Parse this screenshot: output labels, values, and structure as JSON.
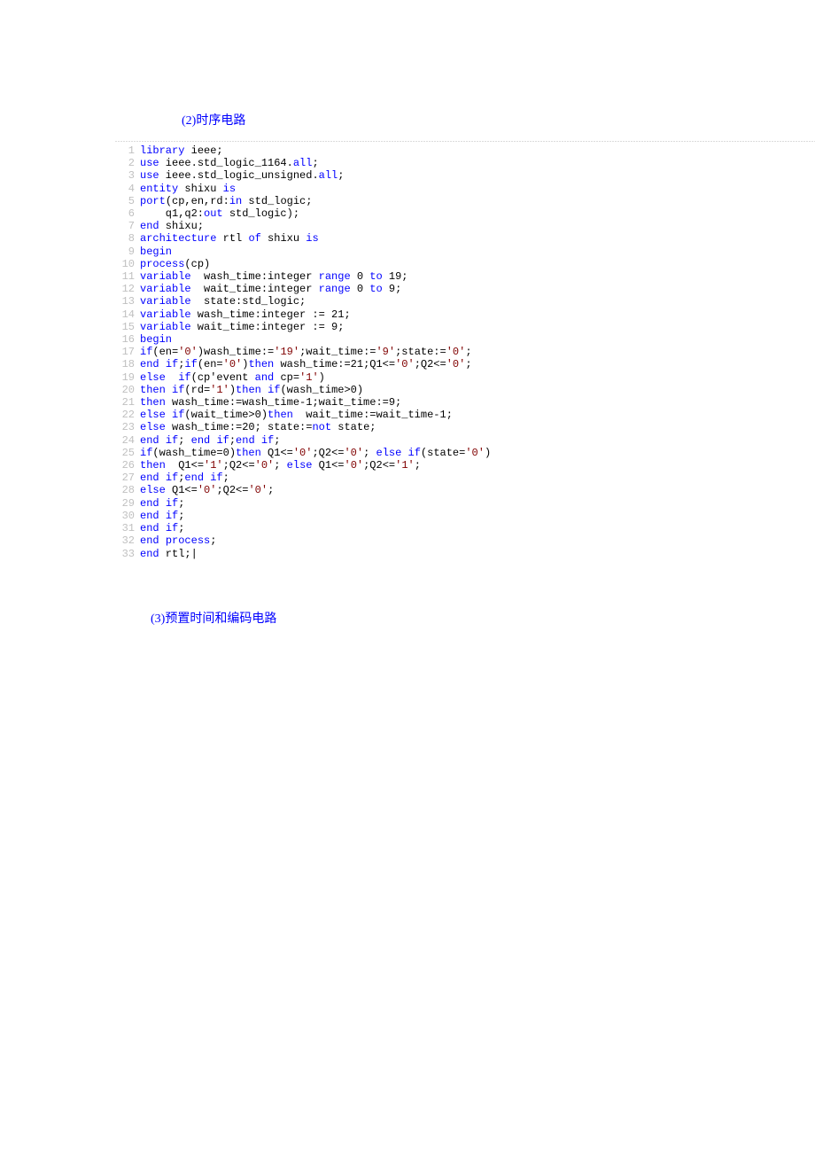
{
  "headings": {
    "h1": "(2)时序电路",
    "h2": "(3)预置时间和编码电路"
  },
  "code": [
    {
      "n": "1",
      "segs": [
        [
          "kw",
          "library"
        ],
        [
          "tx",
          " ieee;"
        ]
      ]
    },
    {
      "n": "2",
      "segs": [
        [
          "kw",
          "use"
        ],
        [
          "tx",
          " ieee.std_logic_1164."
        ],
        [
          "kw",
          "all"
        ],
        [
          "tx",
          ";"
        ]
      ]
    },
    {
      "n": "3",
      "segs": [
        [
          "kw",
          "use"
        ],
        [
          "tx",
          " ieee.std_logic_unsigned."
        ],
        [
          "kw",
          "all"
        ],
        [
          "tx",
          ";"
        ]
      ]
    },
    {
      "n": "4",
      "segs": [
        [
          "kw",
          "entity"
        ],
        [
          "tx",
          " shixu "
        ],
        [
          "kw",
          "is"
        ]
      ]
    },
    {
      "n": "5",
      "segs": [
        [
          "kw",
          "port"
        ],
        [
          "tx",
          "(cp,en,rd:"
        ],
        [
          "kw",
          "in"
        ],
        [
          "tx",
          " std_logic;"
        ]
      ]
    },
    {
      "n": "6",
      "segs": [
        [
          "tx",
          "    q1,q2:"
        ],
        [
          "kw",
          "out"
        ],
        [
          "tx",
          " std_logic);"
        ]
      ]
    },
    {
      "n": "7",
      "segs": [
        [
          "kw",
          "end"
        ],
        [
          "tx",
          " shixu;"
        ]
      ]
    },
    {
      "n": "8",
      "segs": [
        [
          "kw",
          "architecture"
        ],
        [
          "tx",
          " rtl "
        ],
        [
          "kw",
          "of"
        ],
        [
          "tx",
          " shixu "
        ],
        [
          "kw",
          "is"
        ]
      ]
    },
    {
      "n": "9",
      "segs": [
        [
          "kw",
          "begin"
        ]
      ]
    },
    {
      "n": "10",
      "segs": [
        [
          "kw",
          "process"
        ],
        [
          "tx",
          "(cp)"
        ]
      ]
    },
    {
      "n": "11",
      "segs": [
        [
          "kw",
          "variable"
        ],
        [
          "tx",
          "  wash_time:integer "
        ],
        [
          "kw",
          "range"
        ],
        [
          "tx",
          " 0 "
        ],
        [
          "kw",
          "to"
        ],
        [
          "tx",
          " 19;"
        ]
      ]
    },
    {
      "n": "12",
      "segs": [
        [
          "kw",
          "variable"
        ],
        [
          "tx",
          "  wait_time:integer "
        ],
        [
          "kw",
          "range"
        ],
        [
          "tx",
          " 0 "
        ],
        [
          "kw",
          "to"
        ],
        [
          "tx",
          " 9;"
        ]
      ]
    },
    {
      "n": "13",
      "segs": [
        [
          "kw",
          "variable"
        ],
        [
          "tx",
          "  state:std_logic;"
        ]
      ]
    },
    {
      "n": "14",
      "segs": [
        [
          "kw",
          "variable"
        ],
        [
          "tx",
          " wash_time:integer := 21;"
        ]
      ]
    },
    {
      "n": "15",
      "segs": [
        [
          "kw",
          "variable"
        ],
        [
          "tx",
          " wait_time:integer := 9;"
        ]
      ]
    },
    {
      "n": "16",
      "segs": [
        [
          "kw",
          "begin"
        ]
      ]
    },
    {
      "n": "17",
      "segs": [
        [
          "kw",
          "if"
        ],
        [
          "tx",
          "(en="
        ],
        [
          "str",
          "'0'"
        ],
        [
          "tx",
          ")wash_time:="
        ],
        [
          "str",
          "'19'"
        ],
        [
          "tx",
          ";wait_time:="
        ],
        [
          "str",
          "'9'"
        ],
        [
          "tx",
          ";state:="
        ],
        [
          "str",
          "'0'"
        ],
        [
          "tx",
          ";"
        ]
      ]
    },
    {
      "n": "18",
      "segs": [
        [
          "kw",
          "end"
        ],
        [
          "tx",
          " "
        ],
        [
          "kw",
          "if"
        ],
        [
          "tx",
          ";"
        ],
        [
          "kw",
          "if"
        ],
        [
          "tx",
          "(en="
        ],
        [
          "str",
          "'0'"
        ],
        [
          "tx",
          ")"
        ],
        [
          "kw",
          "then"
        ],
        [
          "tx",
          " wash_time:=21;Q1<="
        ],
        [
          "str",
          "'0'"
        ],
        [
          "tx",
          ";Q2<="
        ],
        [
          "str",
          "'0'"
        ],
        [
          "tx",
          ";"
        ]
      ]
    },
    {
      "n": "19",
      "segs": [
        [
          "kw",
          "else"
        ],
        [
          "tx",
          "  "
        ],
        [
          "kw",
          "if"
        ],
        [
          "tx",
          "(cp'event "
        ],
        [
          "kw",
          "and"
        ],
        [
          "tx",
          " cp="
        ],
        [
          "str",
          "'1'"
        ],
        [
          "tx",
          ")"
        ]
      ]
    },
    {
      "n": "20",
      "segs": [
        [
          "kw",
          "then"
        ],
        [
          "tx",
          " "
        ],
        [
          "kw",
          "if"
        ],
        [
          "tx",
          "(rd="
        ],
        [
          "str",
          "'1'"
        ],
        [
          "tx",
          ")"
        ],
        [
          "kw",
          "then"
        ],
        [
          "tx",
          " "
        ],
        [
          "kw",
          "if"
        ],
        [
          "tx",
          "(wash_time>0)"
        ]
      ]
    },
    {
      "n": "21",
      "segs": [
        [
          "kw",
          "then"
        ],
        [
          "tx",
          " wash_time:=wash_time-1;wait_time:=9;"
        ]
      ]
    },
    {
      "n": "22",
      "segs": [
        [
          "kw",
          "else"
        ],
        [
          "tx",
          " "
        ],
        [
          "kw",
          "if"
        ],
        [
          "tx",
          "(wait_time>0)"
        ],
        [
          "kw",
          "then"
        ],
        [
          "tx",
          "  wait_time:=wait_time-1;"
        ]
      ]
    },
    {
      "n": "23",
      "segs": [
        [
          "kw",
          "else"
        ],
        [
          "tx",
          " wash_time:=20; state:="
        ],
        [
          "kw",
          "not"
        ],
        [
          "tx",
          " state;"
        ]
      ]
    },
    {
      "n": "24",
      "segs": [
        [
          "kw",
          "end"
        ],
        [
          "tx",
          " "
        ],
        [
          "kw",
          "if"
        ],
        [
          "tx",
          "; "
        ],
        [
          "kw",
          "end"
        ],
        [
          "tx",
          " "
        ],
        [
          "kw",
          "if"
        ],
        [
          "tx",
          ";"
        ],
        [
          "kw",
          "end"
        ],
        [
          "tx",
          " "
        ],
        [
          "kw",
          "if"
        ],
        [
          "tx",
          ";"
        ]
      ]
    },
    {
      "n": "25",
      "segs": [
        [
          "kw",
          "if"
        ],
        [
          "tx",
          "(wash_time=0)"
        ],
        [
          "kw",
          "then"
        ],
        [
          "tx",
          " Q1<="
        ],
        [
          "str",
          "'0'"
        ],
        [
          "tx",
          ";Q2<="
        ],
        [
          "str",
          "'0'"
        ],
        [
          "tx",
          "; "
        ],
        [
          "kw",
          "else"
        ],
        [
          "tx",
          " "
        ],
        [
          "kw",
          "if"
        ],
        [
          "tx",
          "(state="
        ],
        [
          "str",
          "'0'"
        ],
        [
          "tx",
          ")"
        ]
      ]
    },
    {
      "n": "26",
      "segs": [
        [
          "kw",
          "then"
        ],
        [
          "tx",
          "  Q1<="
        ],
        [
          "str",
          "'1'"
        ],
        [
          "tx",
          ";Q2<="
        ],
        [
          "str",
          "'0'"
        ],
        [
          "tx",
          "; "
        ],
        [
          "kw",
          "else"
        ],
        [
          "tx",
          " Q1<="
        ],
        [
          "str",
          "'0'"
        ],
        [
          "tx",
          ";Q2<="
        ],
        [
          "str",
          "'1'"
        ],
        [
          "tx",
          ";"
        ]
      ]
    },
    {
      "n": "27",
      "segs": [
        [
          "kw",
          "end"
        ],
        [
          "tx",
          " "
        ],
        [
          "kw",
          "if"
        ],
        [
          "tx",
          ";"
        ],
        [
          "kw",
          "end"
        ],
        [
          "tx",
          " "
        ],
        [
          "kw",
          "if"
        ],
        [
          "tx",
          ";"
        ]
      ]
    },
    {
      "n": "28",
      "segs": [
        [
          "kw",
          "else"
        ],
        [
          "tx",
          " Q1<="
        ],
        [
          "str",
          "'0'"
        ],
        [
          "tx",
          ";Q2<="
        ],
        [
          "str",
          "'0'"
        ],
        [
          "tx",
          ";"
        ]
      ]
    },
    {
      "n": "29",
      "segs": [
        [
          "kw",
          "end"
        ],
        [
          "tx",
          " "
        ],
        [
          "kw",
          "if"
        ],
        [
          "tx",
          ";"
        ]
      ]
    },
    {
      "n": "30",
      "segs": [
        [
          "kw",
          "end"
        ],
        [
          "tx",
          " "
        ],
        [
          "kw",
          "if"
        ],
        [
          "tx",
          ";"
        ]
      ]
    },
    {
      "n": "31",
      "segs": [
        [
          "kw",
          "end"
        ],
        [
          "tx",
          " "
        ],
        [
          "kw",
          "if"
        ],
        [
          "tx",
          ";"
        ]
      ]
    },
    {
      "n": "32",
      "segs": [
        [
          "kw",
          "end"
        ],
        [
          "tx",
          " "
        ],
        [
          "kw",
          "process"
        ],
        [
          "tx",
          ";"
        ]
      ]
    },
    {
      "n": "33",
      "segs": [
        [
          "kw",
          "end"
        ],
        [
          "tx",
          " rtl;|"
        ]
      ]
    }
  ]
}
